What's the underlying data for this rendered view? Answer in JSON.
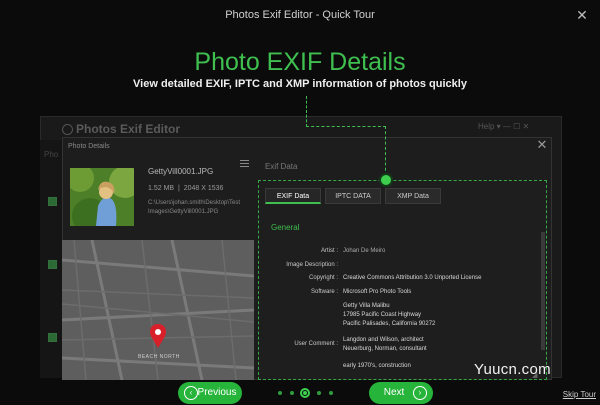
{
  "window": {
    "title": "Photos Exif Editor - Quick Tour",
    "close_label": "✕"
  },
  "tour": {
    "headline": "Photo EXIF Details",
    "subheadline": "View detailed EXIF, IPTC and XMP information of photos quickly"
  },
  "background_app": {
    "title": "Photos Exif Editor",
    "controls": "Help ▾ — ☐ ✕",
    "label": "Pho"
  },
  "dialog": {
    "title": "Photo Details",
    "close_label": "✕",
    "file_name": "GettyVill0001.JPG",
    "file_size": "1.52 MB",
    "resolution": "2048 X 1536",
    "file_path": "C:\\Users\\johan.smith\\Desktop\\Test Images\\GettyVill0001.JPG",
    "map_place_label": "BEACH NORTH",
    "exif_data_label": "Exif Data",
    "tabs": [
      {
        "label": "EXIF Data",
        "active": true
      },
      {
        "label": "IPTC DATA",
        "active": false
      },
      {
        "label": "XMP Data",
        "active": false
      }
    ],
    "section_title": "General",
    "fields": {
      "artist_label": "Artist :",
      "artist_value": "Johan De Meiro",
      "image_description_label": "Image Description :",
      "copyright_label": "Copyright :",
      "copyright_value": "Creative Commons Attribution 3.0 Unported License",
      "software_label": "Software :",
      "software_value": "Microsoft Pro Photo Tools",
      "address_line1": "Getty Villa Malibu",
      "address_line2": "17985 Pacific Coast Highway",
      "address_line3": "Pacific Palisades, California 90272",
      "user_comment_label": "User Comment :",
      "user_comment_line1": "Langdon and Wilson, architect",
      "user_comment_line2": "Neuerburg, Norman, consultant",
      "user_comment_line3": "early 1970's, construction"
    }
  },
  "footer": {
    "previous_label": "Previous",
    "next_label": "Next",
    "skip_label": "Skip Tour",
    "pagination": {
      "total": 5,
      "current": 3
    }
  },
  "watermark": "Yuucn.com",
  "colors": {
    "accent": "#3fbf4f",
    "button": "#26b43a",
    "background": "#0b0b0b"
  }
}
